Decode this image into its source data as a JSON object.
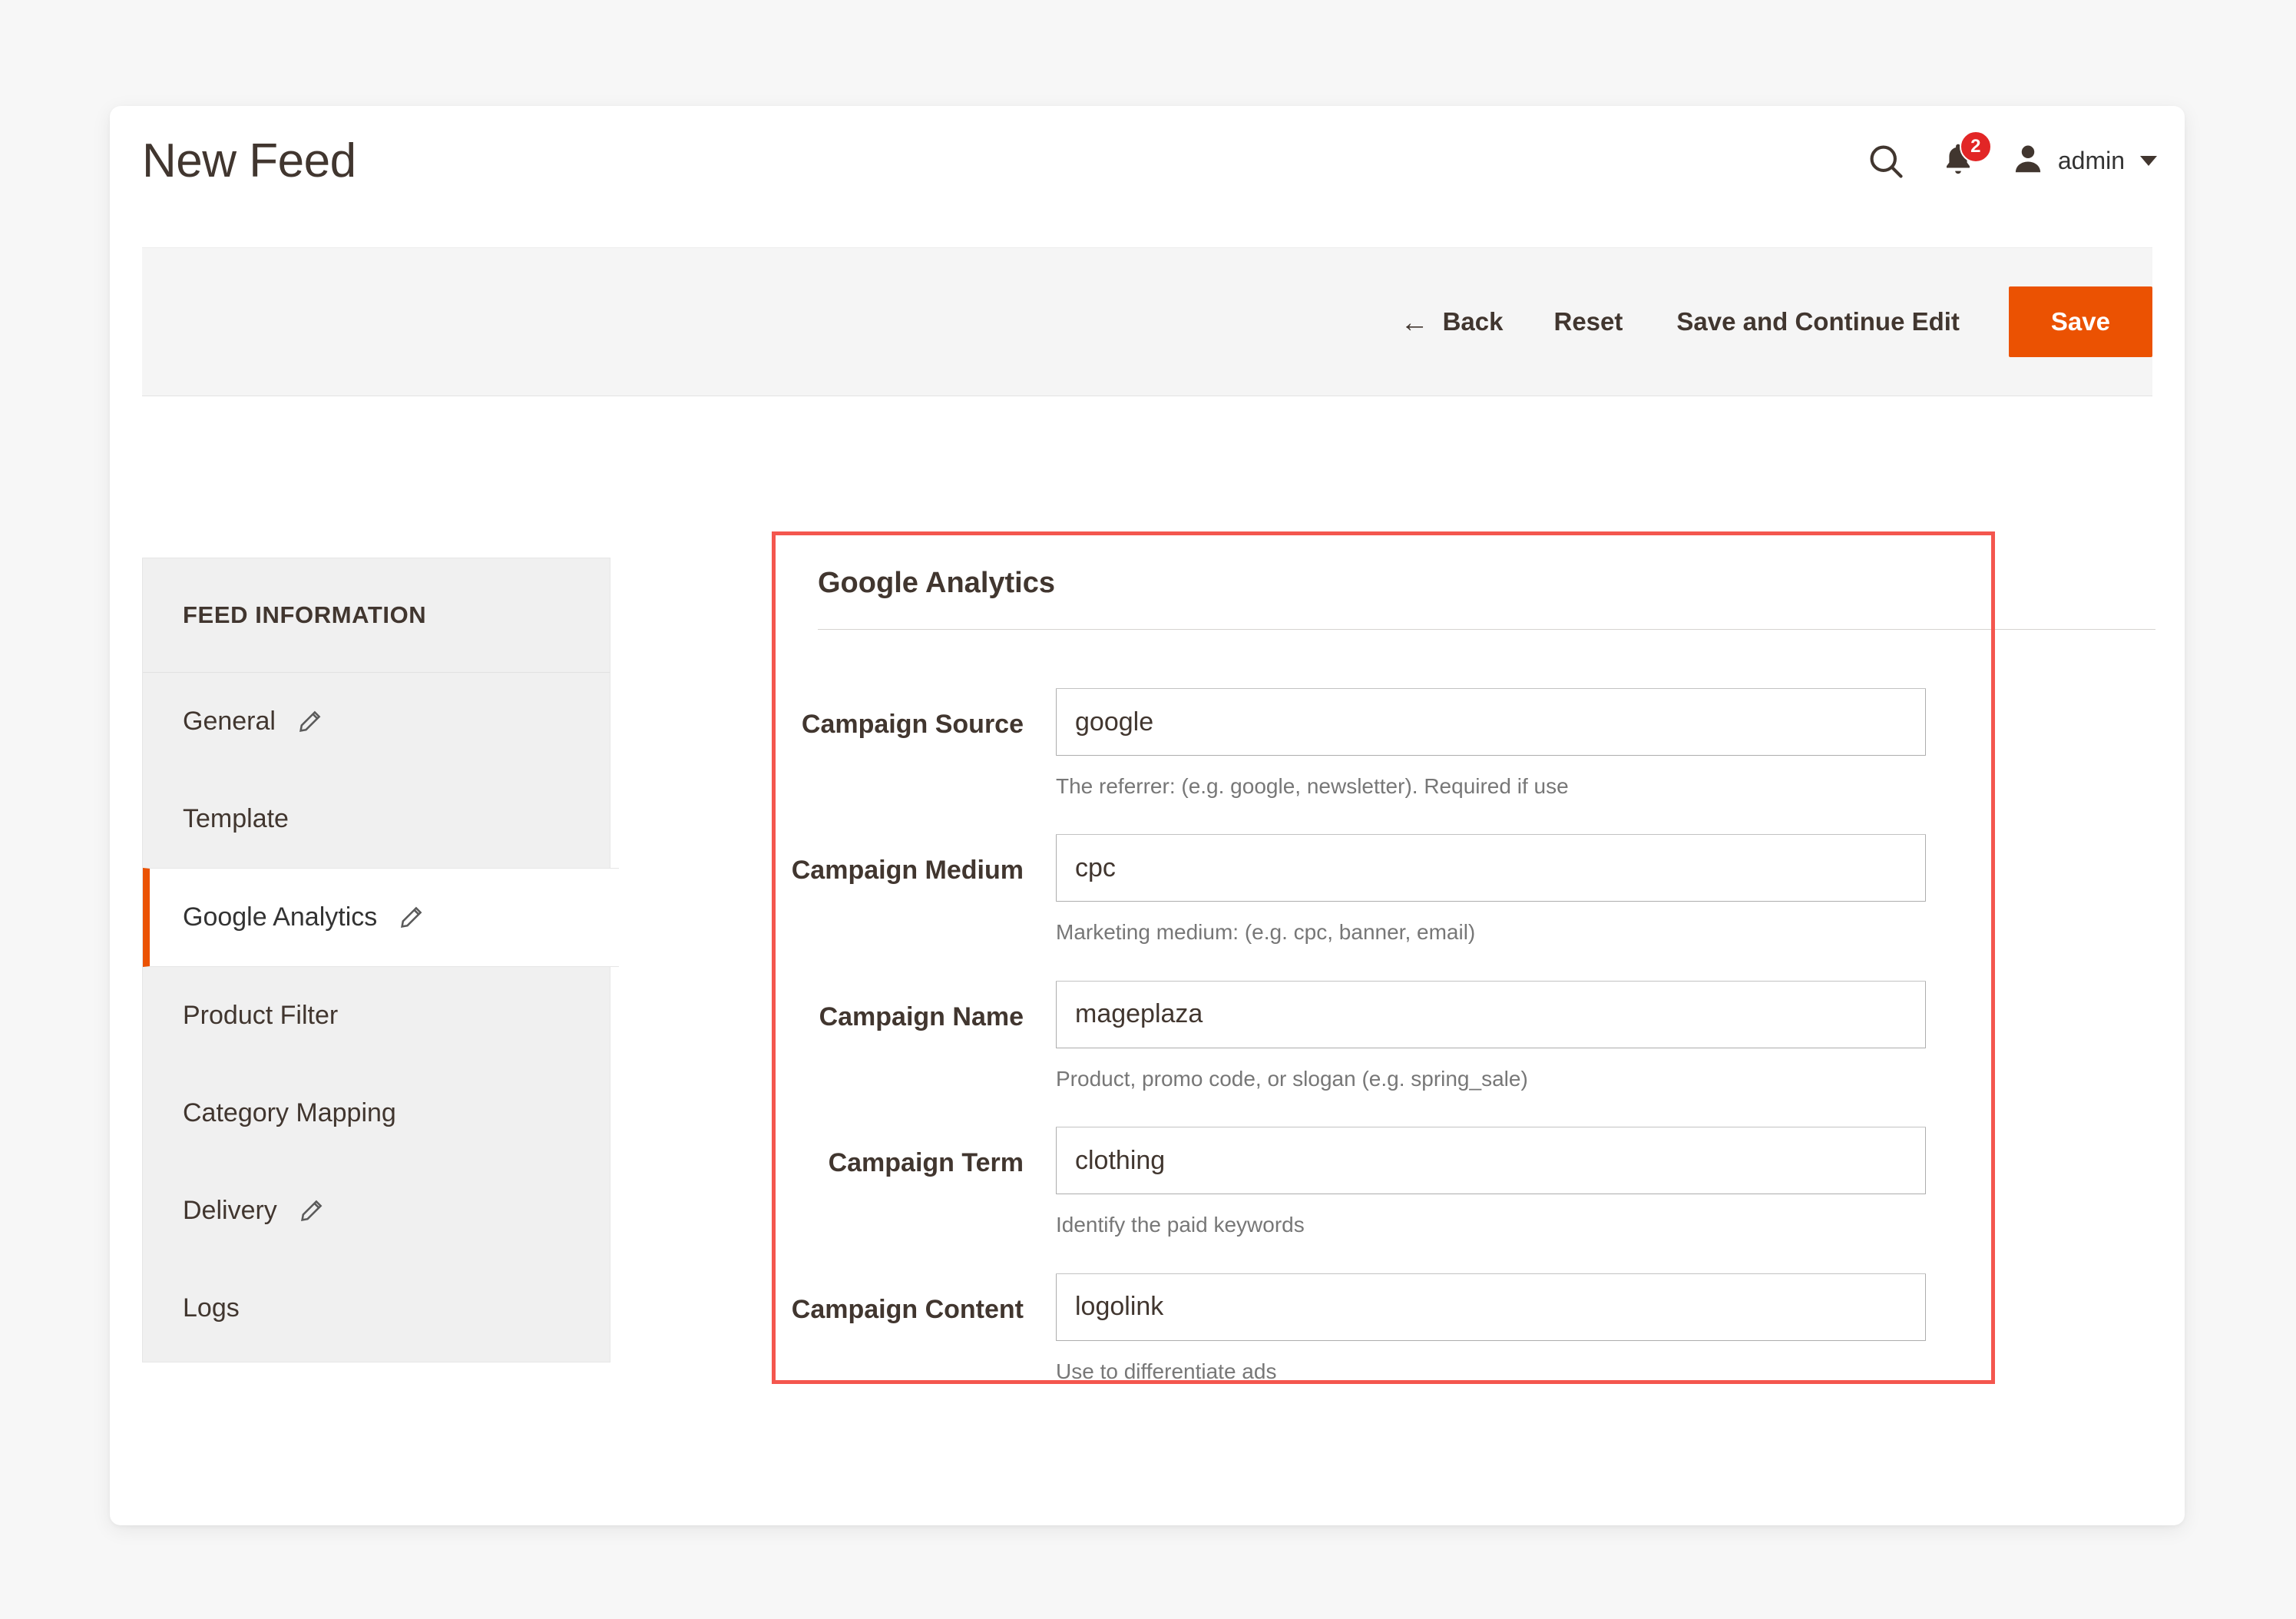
{
  "header": {
    "title": "New Feed",
    "search_icon": "search-icon",
    "notifications": {
      "icon": "bell-icon",
      "count": "2",
      "badge_color": "#e22626"
    },
    "user": {
      "avatar_icon": "user-avatar-icon",
      "name": "admin",
      "caret_icon": "chevron-down-icon"
    }
  },
  "toolbar": {
    "back_arrow": "←",
    "back_label": "Back",
    "reset_label": "Reset",
    "save_continue_label": "Save and Continue Edit",
    "save_label": "Save",
    "primary_color": "#eb5202"
  },
  "sidebar": {
    "title": "FEED INFORMATION",
    "active_accent": "#eb5202",
    "items": [
      {
        "label": "General",
        "icon": "pencil-icon",
        "has_icon": true,
        "active": false
      },
      {
        "label": "Template",
        "icon": "",
        "has_icon": false,
        "active": false
      },
      {
        "label": "Google Analytics",
        "icon": "pencil-icon",
        "has_icon": true,
        "active": true
      },
      {
        "label": "Product Filter",
        "icon": "",
        "has_icon": false,
        "active": false
      },
      {
        "label": "Category Mapping",
        "icon": "",
        "has_icon": false,
        "active": false
      },
      {
        "label": "Delivery",
        "icon": "pencil-icon",
        "has_icon": true,
        "active": false
      },
      {
        "label": "Logs",
        "icon": "",
        "has_icon": false,
        "active": false
      }
    ]
  },
  "form": {
    "section_title": "Google Analytics",
    "annotation_color": "#f4564e",
    "fields": [
      {
        "label": "Campaign Source",
        "value": "google",
        "note": "The referrer: (e.g. google, newsletter). Required if use"
      },
      {
        "label": "Campaign Medium",
        "value": "cpc",
        "note": "Marketing medium: (e.g. cpc, banner, email)"
      },
      {
        "label": "Campaign Name",
        "value": "mageplaza",
        "note": "Product, promo code, or slogan (e.g. spring_sale)"
      },
      {
        "label": "Campaign Term",
        "value": "clothing",
        "note": "Identify the paid keywords"
      },
      {
        "label": "Campaign Content",
        "value": "logolink",
        "note": "Use to differentiate ads"
      }
    ]
  }
}
